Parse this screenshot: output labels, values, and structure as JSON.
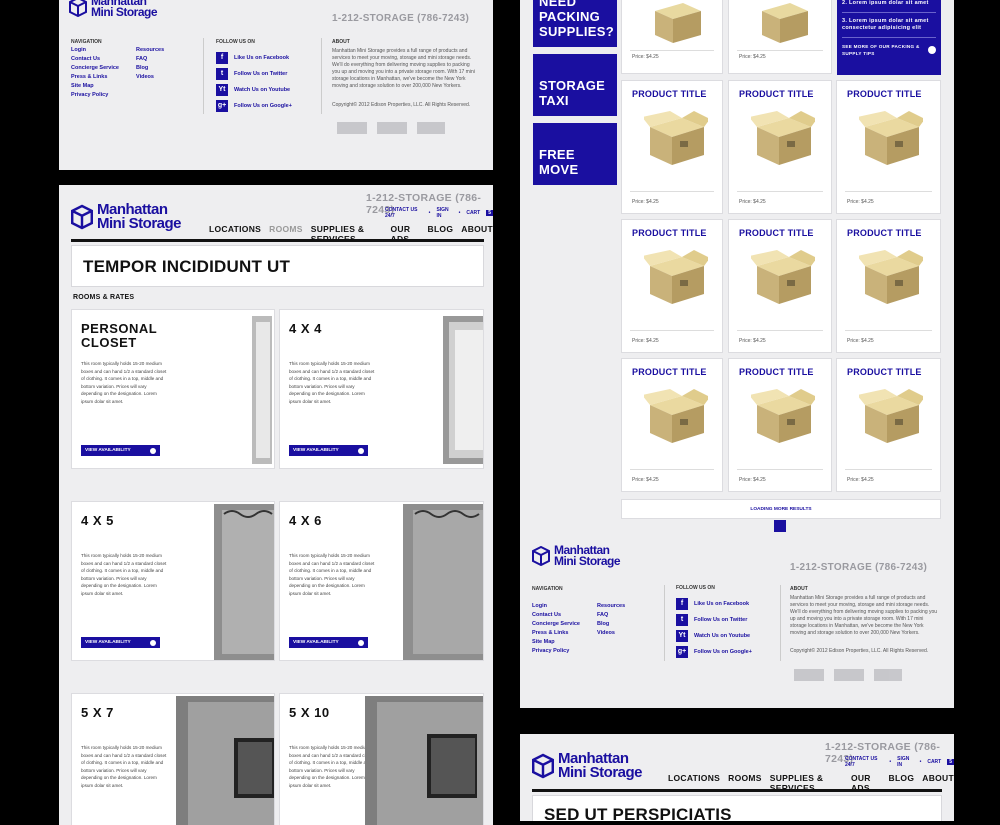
{
  "brand": {
    "line1": "Manhattan",
    "line2": "Mini Storage",
    "phone": "1-212-STORAGE (786-7243)"
  },
  "util": {
    "contact": "CONTACT US 24/7",
    "sign_in": "SIGN IN",
    "cart": "CART",
    "cart_count": "5",
    "sep": "•"
  },
  "nav": [
    "LOCATIONS",
    "ROOMS",
    "SUPPLIES & SERVICES",
    "OUR ADS",
    "BLOG",
    "ABOUT"
  ],
  "footer": {
    "nav_heading": "NAVIGATION",
    "links_col1": [
      "Login",
      "Contact Us",
      "Concierge Service",
      "Press & Links",
      "Site Map",
      "Privacy Policy"
    ],
    "links_col2": [
      "Resources",
      "FAQ",
      "Blog",
      "Videos"
    ],
    "follow_heading": "FOLLOW US ON",
    "social": [
      {
        "icon": "f",
        "label": "Like Us on Facebook",
        "icon_name": "facebook-icon"
      },
      {
        "icon": "t",
        "label": "Follow Us on Twitter",
        "icon_name": "twitter-icon"
      },
      {
        "icon": "Yt",
        "label": "Watch Us on Youtube",
        "icon_name": "youtube-icon"
      },
      {
        "icon": "g+",
        "label": "Follow Us on Google+",
        "icon_name": "googleplus-icon"
      }
    ],
    "about_heading": "ABOUT",
    "about_text": "Manhattan Mini Storage provides a full range of products and services to meet your moving, storage and mini storage needs. We'll do everything from delivering moving supplies to packing you up and moving you into a private storage room. With 17 mini storage locations in Manhattan, we've become the New York moving and storage solution to over 200,000 New Yorkers.",
    "copyright": "Copyright© 2012 Edison Properties, LLC. All Rights Reserved."
  },
  "rooms_page": {
    "title": "TEMPOR INCIDIDUNT UT",
    "section": "ROOMS & RATES",
    "cta": "VIEW AVAILABILITY",
    "rooms": [
      {
        "name": "PERSONAL CLOSET",
        "desc": "This room typically holds 15-20 medium boxes and can hand 1/2 a standard closet of clothing. It comes in a top, middle and bottom variation. Prices will vary depending on the designation. Lorem ipsum dolar sit amet."
      },
      {
        "name": "4 X 4",
        "desc": "This room typically holds 15-20 medium boxes and can hand 1/2 a standard closet of clothing. It comes in a top, middle and bottom variation. Prices will vary depending on the designation. Lorem ipsum dolar sit amet."
      },
      {
        "name": "4 X 5",
        "desc": "This room typically holds 15-20 medium boxes and can hand 1/2 a standard closet of clothing. It comes in a top, middle and bottom variation. Prices will vary depending on the designation. Lorem ipsum dolar sit amet."
      },
      {
        "name": "4 X 6",
        "desc": "This room typically holds 15-20 medium boxes and can hand 1/2 a standard closet of clothing. It comes in a top, middle and bottom variation. Prices will vary depending on the designation. Lorem ipsum dolar sit amet."
      },
      {
        "name": "5 X 7",
        "desc": "This room typically holds 15-20 medium boxes and can hand 1/2 a standard closet of clothing. It comes in a top, middle and bottom variation. Prices will vary depending on the designation. Lorem ipsum dolar sit amet."
      },
      {
        "name": "5 X 10",
        "desc": "This room typically holds 15-20 medium boxes and can hand 1/2 a standard closet of clothing. It comes in a top, middle and bottom variation. Prices will vary depending on the designation. Lorem ipsum dolar sit amet."
      }
    ]
  },
  "supplies_page": {
    "promos": [
      "NEED PACKING SUPPLIES?",
      "STORAGE TAXI",
      "FREE MOVE"
    ],
    "tips": [
      "2. Lorem ipsum dolar sit amet",
      "3. Lorem ipsum dolar sit amet consectetur adipisicing elit"
    ],
    "tips_more": "SEE MORE OF OUR PACKING & SUPPLY TIPS",
    "product_title": "PRODUCT TITLE",
    "price": "Price: $4.25",
    "loading": "LOADING MORE RESULTS"
  },
  "bottom_page": {
    "title": "SED UT PERSPICIATIS"
  }
}
